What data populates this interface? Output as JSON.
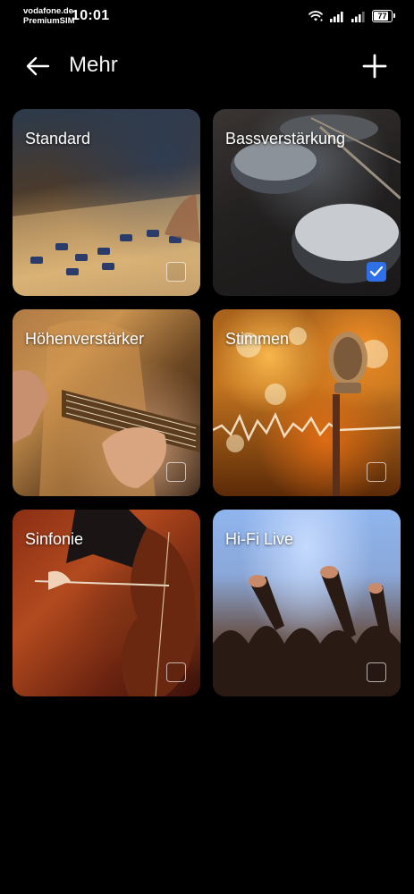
{
  "status_bar": {
    "carrier_line1": "vodafone.de",
    "carrier_line2": "PremiumSIM",
    "time": "10:01",
    "battery": "77",
    "icons": [
      "wifi-icon",
      "signal-icon",
      "signal-icon",
      "battery-icon"
    ]
  },
  "header": {
    "title": "Mehr",
    "back_icon": "arrow-left-icon",
    "add_icon": "plus-icon"
  },
  "presets": [
    {
      "label": "Standard",
      "checked": false
    },
    {
      "label": "Bassverstärkung",
      "checked": true
    },
    {
      "label": "Höhenverstärker",
      "checked": false
    },
    {
      "label": "Stimmen",
      "checked": false
    },
    {
      "label": "Sinfonie",
      "checked": false
    },
    {
      "label": "Hi-Fi Live",
      "checked": false
    }
  ],
  "colors": {
    "background": "#000000",
    "accent": "#2f6fe8"
  }
}
